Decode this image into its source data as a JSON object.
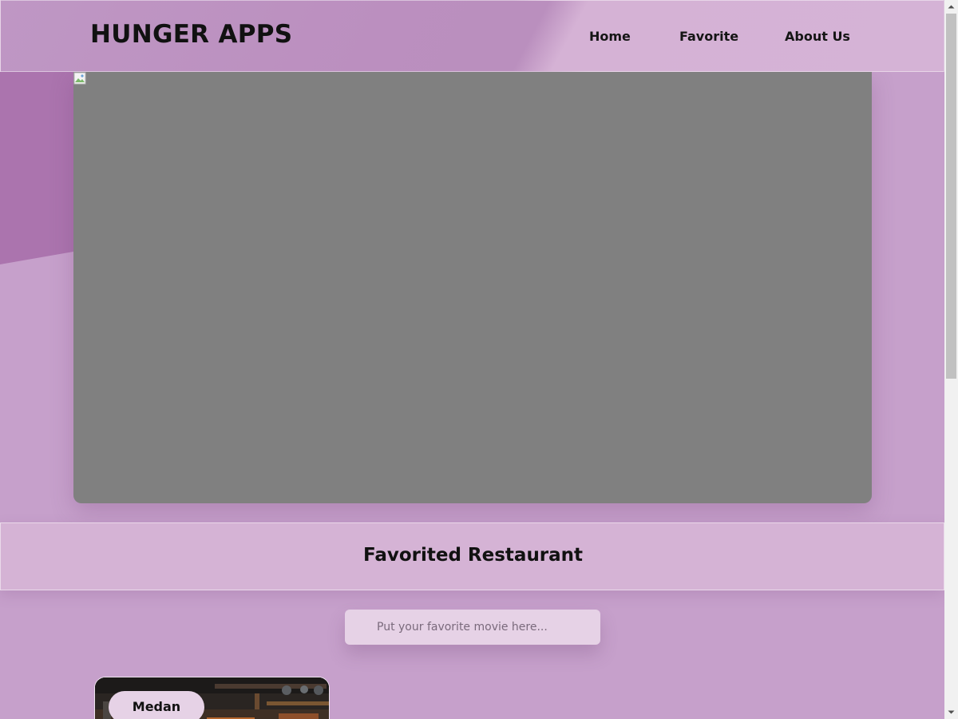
{
  "header": {
    "brand": "HUNGER APPS",
    "nav": [
      {
        "label": "Home"
      },
      {
        "label": "Favorite"
      },
      {
        "label": "About Us"
      }
    ]
  },
  "hero": {
    "image_state": "broken-image"
  },
  "favorites": {
    "title": "Favorited Restaurant",
    "search_placeholder": "Put your favorite movie here...",
    "search_value": "",
    "cards": [
      {
        "city": "Medan"
      }
    ]
  },
  "colors": {
    "background": "#c6a0cb",
    "header_accent": "#bb8fbf",
    "title_bar": "#d5b3d5",
    "input_bg": "#e6d2e6",
    "hero_placeholder": "#808080"
  }
}
